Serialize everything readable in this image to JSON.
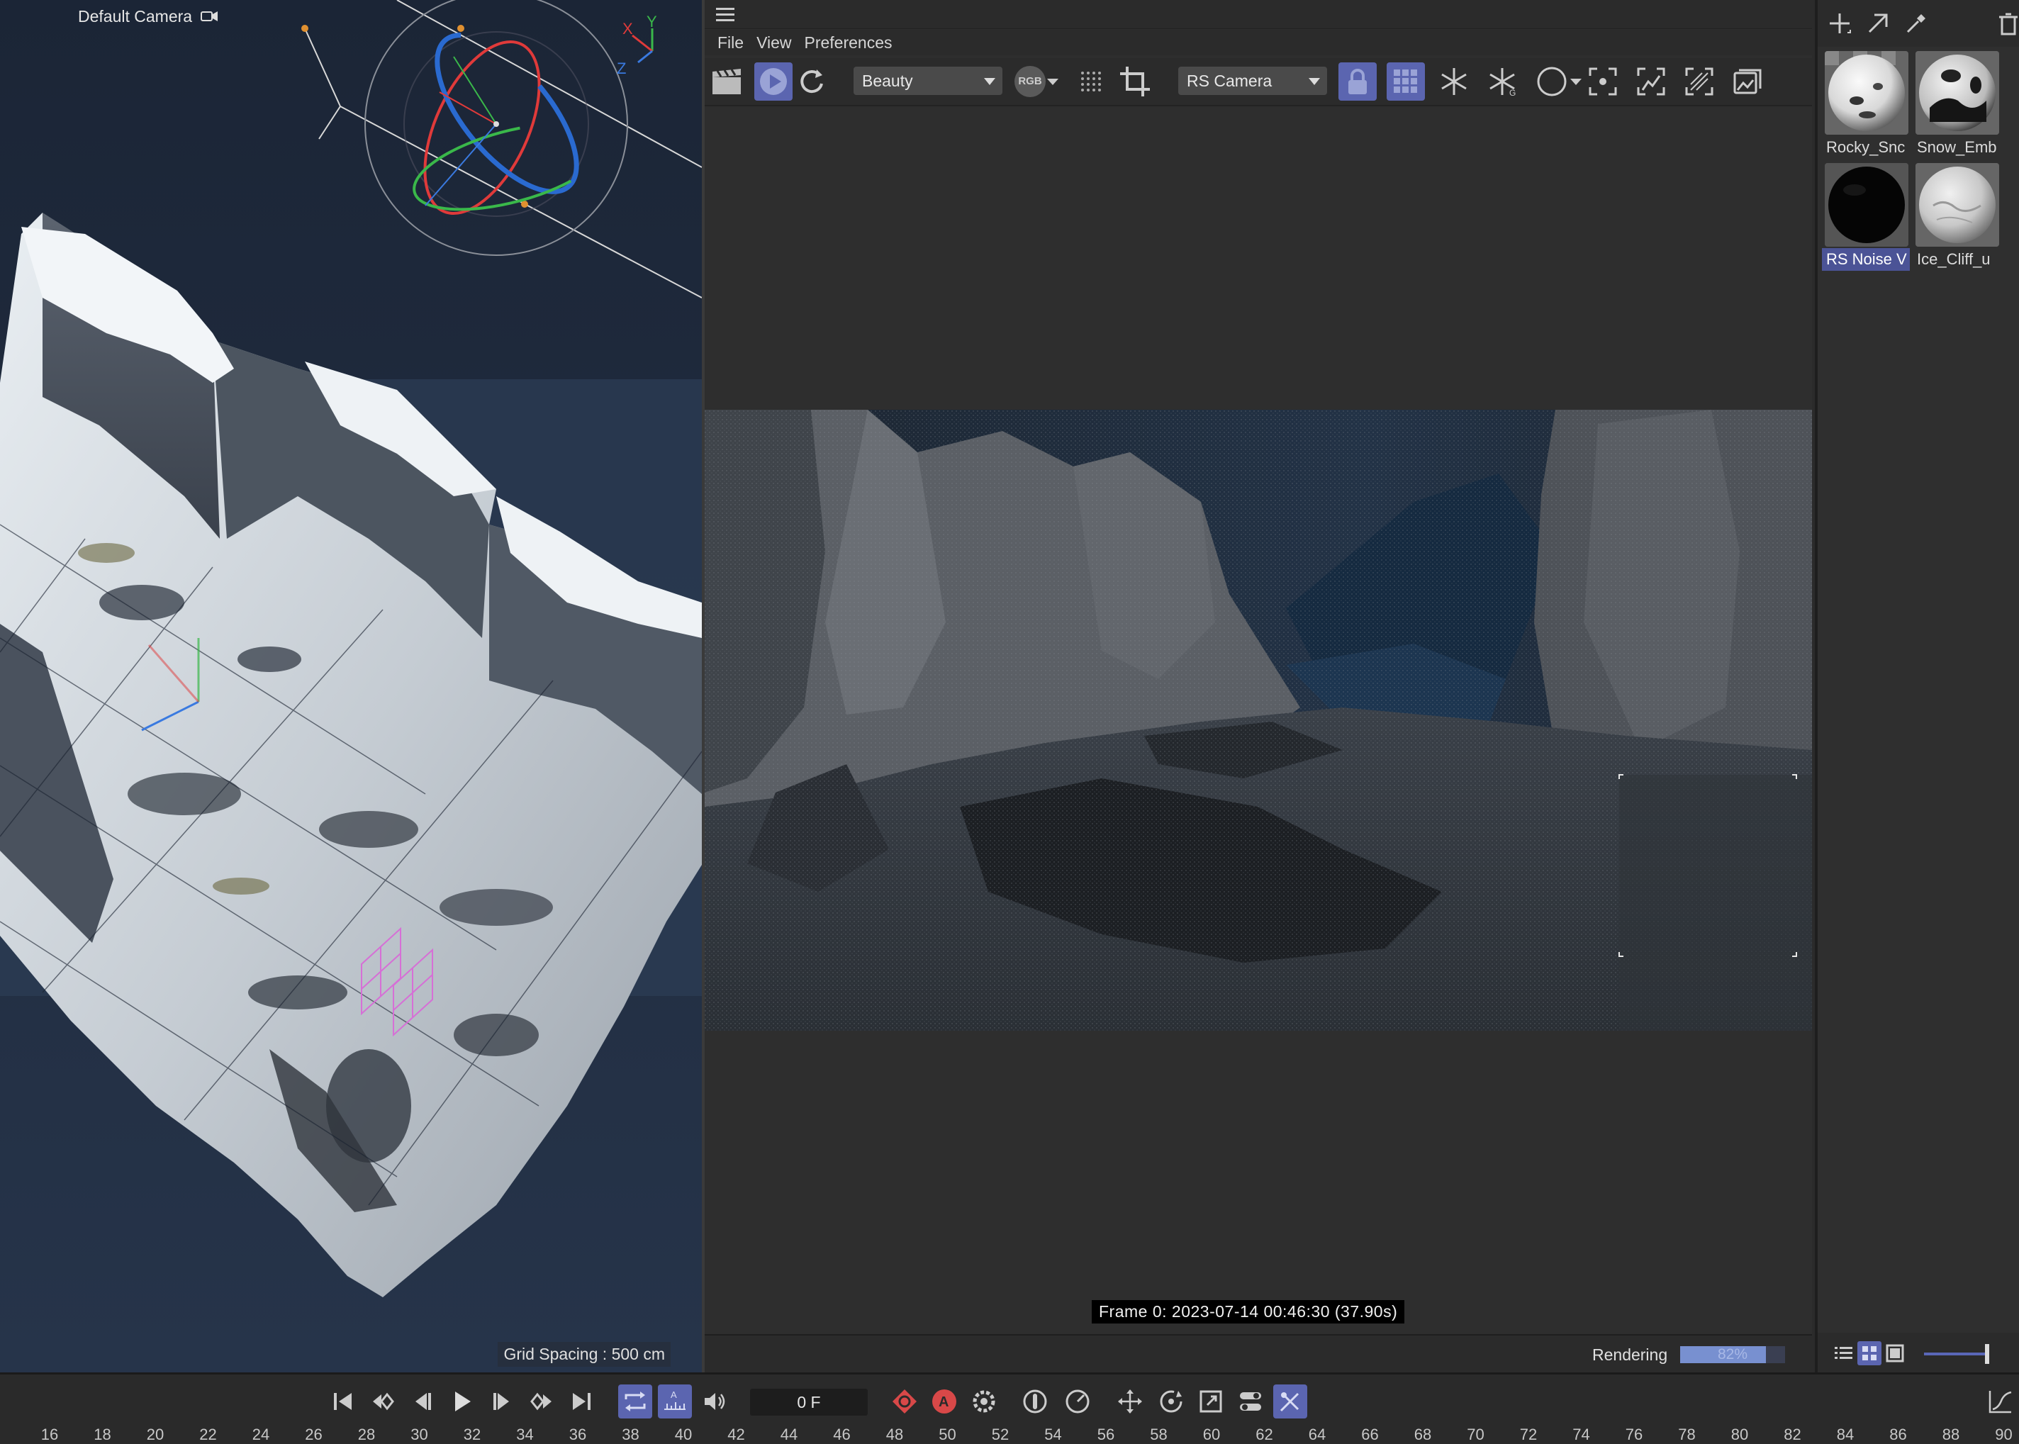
{
  "viewport": {
    "camera_label": "Default Camera",
    "grid_spacing": "Grid Spacing : 500 cm",
    "axis_labels": {
      "x": "X",
      "y": "Y",
      "z": "Z"
    }
  },
  "render_view": {
    "menu": [
      "File",
      "View",
      "Preferences"
    ],
    "aov_dropdown": "Beauty",
    "channel_badge": "RGB",
    "camera_dropdown": "RS Camera",
    "frame_info": "Frame  0:  2023-07-14  00:46:30  (37.90s)",
    "status_label": "Rendering",
    "progress_text": "82%",
    "progress_percent": 82
  },
  "materials": {
    "items": [
      {
        "label": "Rocky_Snc",
        "selected": false,
        "style": "snow-rock"
      },
      {
        "label": "Snow_Emb",
        "selected": false,
        "style": "snow-dark"
      },
      {
        "label": "RS Noise V",
        "selected": true,
        "style": "black"
      },
      {
        "label": "Ice_Cliff_u",
        "selected": false,
        "style": "ice"
      }
    ]
  },
  "timeline": {
    "current_frame": "0 F",
    "ruler_labels": [
      "16",
      "18",
      "20",
      "22",
      "24",
      "26",
      "28",
      "30",
      "32",
      "34",
      "36",
      "38",
      "40",
      "42",
      "44",
      "46",
      "48",
      "50",
      "52",
      "54",
      "56",
      "58",
      "60",
      "62",
      "64",
      "66",
      "68",
      "70",
      "72",
      "74",
      "76",
      "78",
      "80",
      "82",
      "84",
      "86",
      "88",
      "90"
    ]
  },
  "colors": {
    "accent": "#5b65b0",
    "selection": "#4b5396",
    "progress": "#7890d0",
    "axis_x": "#e03a3a",
    "axis_y": "#3ab84a",
    "axis_z": "#3a7ae0"
  }
}
